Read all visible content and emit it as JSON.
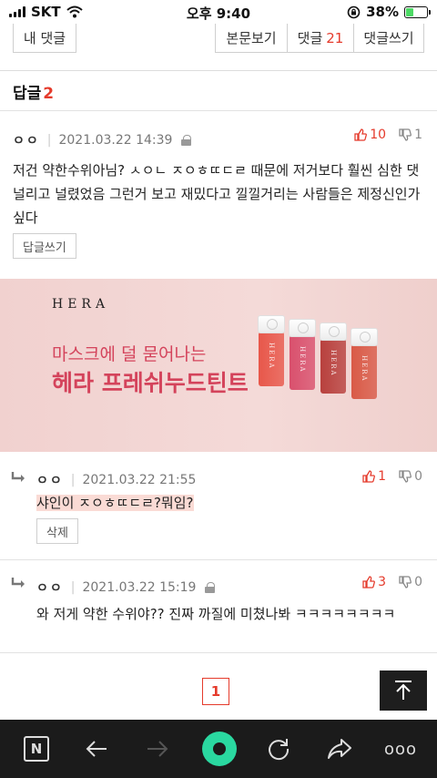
{
  "status_bar": {
    "carrier": "SKT",
    "time": "오후 9:40",
    "battery": "38%",
    "battery_level": 0.38,
    "icons": [
      "signal-bars-icon",
      "wifi-icon",
      "rotation-lock-icon",
      "battery-icon"
    ]
  },
  "top_tabs": {
    "my_comments": "내 댓글",
    "view_post": "본문보기",
    "comments_label": "댓글",
    "comments_count": "21",
    "write_comment": "댓글쓰기"
  },
  "replies_header": {
    "label": "답글",
    "count": "2"
  },
  "main_comment": {
    "author": "ㅇㅇ",
    "date": "2021.03.22 14:39",
    "upvotes": "10",
    "downvotes": "1",
    "text_line1": "저건 약한수위아님? ㅅㅇㄴ ㅈㅇㅎㄸㄷㄹ 때문에 저거보다 훨씬 심한 댓",
    "text_line2": "널리고 널렸었음 그런거 보고 재밌다고 낄낄거리는 사람들은 제정신인가",
    "text_line3": "싶다",
    "reply_button": "답글쓰기"
  },
  "ad": {
    "brand": "HERA",
    "headline": "마스크에 덜 묻어나는",
    "product": "헤라 프레쉬누드틴트",
    "bottle_label": "HERA",
    "bottle_colors": [
      "#e8574a",
      "#d9506d",
      "#b8403d",
      "#d95a47"
    ]
  },
  "reply_1": {
    "author": "ㅇㅇ",
    "date": "2021.03.22 21:55",
    "upvotes": "1",
    "downvotes": "0",
    "text": "샤인이 ㅈㅇㅎㄸㄷㄹ?뭐임?",
    "delete_button": "삭제"
  },
  "reply_2": {
    "author": "ㅇㅇ",
    "date": "2021.03.22 15:19",
    "upvotes": "3",
    "downvotes": "0",
    "text": "와 저게 약한 수위야?? 진짜 까질에 미쳤나봐 ㅋㅋㅋㅋㅋㅋㅋㅋ"
  },
  "pagination": {
    "current_page": "1"
  },
  "browser_bar": {
    "icons": [
      "naver-n-icon",
      "back-arrow-icon",
      "forward-arrow-icon",
      "green-dot-icon",
      "refresh-icon",
      "share-icon",
      "more-icon"
    ],
    "n_label": "N",
    "more_label": "ooo"
  }
}
